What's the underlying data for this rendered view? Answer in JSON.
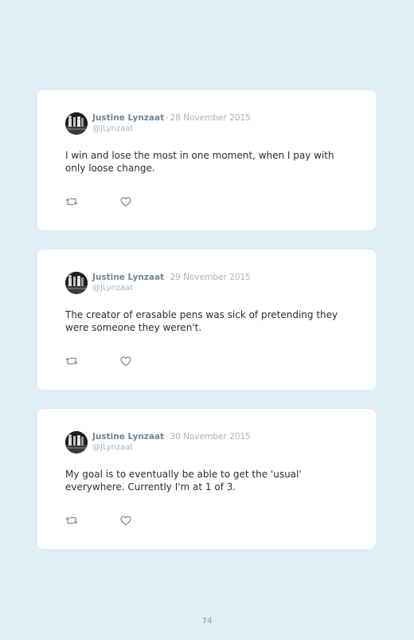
{
  "tweets": [
    {
      "author": "Justine Lynzaat",
      "separator": "·",
      "date": "28 November 2015",
      "handle": "@JLynzaat",
      "text": "I win and lose the most in one moment, when I pay with only loose change."
    },
    {
      "author": "Justine Lynzaat",
      "separator": "·",
      "date": "29 November 2015",
      "handle": "@JLynzaat",
      "text": "The creator of erasable pens was sick of pretending they were someone they weren't."
    },
    {
      "author": "Justine Lynzaat",
      "separator": "·",
      "date": "30 November 2015",
      "handle": "@JLynzaat",
      "text": "My goal is to eventually be able to get the 'usual' everywhere. Currently I'm at 1 of 3."
    }
  ],
  "icons": {
    "retweet": "retweet-icon",
    "like": "heart-icon",
    "avatar": "avatar"
  },
  "colors": {
    "background": "#dfedf5",
    "card": "#ffffff",
    "author": "#6e8494",
    "muted": "#a6b4bf",
    "text": "#2c2c2c"
  },
  "page": {
    "number": "74"
  }
}
